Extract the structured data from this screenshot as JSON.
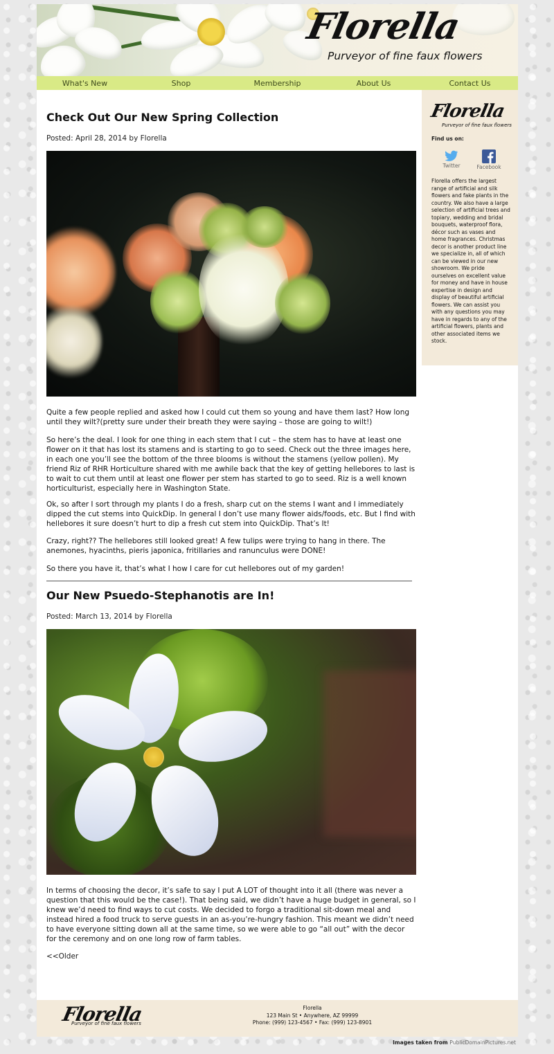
{
  "header": {
    "logo_title": "Florella",
    "logo_tagline": "Purveyor of fine faux flowers"
  },
  "nav": {
    "items": [
      "What's New",
      "Shop",
      "Membership",
      "About Us",
      "Contact Us"
    ]
  },
  "posts": [
    {
      "title": "Check Out Our New Spring Collection",
      "meta": "Posted: April 28, 2014 by Florella",
      "paragraphs": [
        "Quite a few people replied and asked how I could cut them so young and have them last? How long until they wilt?(pretty sure under their breath they were saying – those are going to wilt!)",
        "So here’s the deal. I look for one thing in each stem that I cut – the stem has to have at least one flower on it that has lost its stamens and is starting to go to seed. Check out the three images here, in each one you’ll see the bottom of the three blooms is without the stamens (yellow pollen). My friend Riz of RHR Horticulture shared with me awhile back that the key of getting hellebores to last is to wait to cut them until at least one flower per stem has started to go to seed. Riz is a well known horticulturist, especially here in Washington State.",
        "Ok, so after I sort through my plants I do a fresh, sharp cut on the stems I want and I immediately dipped the cut stems into QuickDip. In general I don’t use many flower aids/foods, etc. But I find with hellebores it sure doesn’t hurt to dip a fresh cut stem into QuickDip. That’s It!",
        "Crazy, right?? The hellebores still looked great! A few tulips were trying to hang in there. The anemones, hyacinths, pieris japonica, fritillaries and ranunculus were DONE!",
        "So there you have it, that’s what I how I care for cut hellebores out of my garden!"
      ]
    },
    {
      "title": "Our New Psuedo-Stephanotis are In!",
      "meta": "Posted: March 13, 2014 by Florella",
      "paragraphs": [
        "In terms of choosing the decor, it’s safe to say I put A LOT of thought into it all (there was never a question that this would be the case!). That being said, we didn’t have a huge budget in general, so I knew we’d need to find ways to cut costs. We decided to forgo a traditional sit-down meal and instead hired a food truck to serve guests in an as-you’re-hungry fashion. This meant we didn’t need to have everyone sitting down all at the same time, so we were able to go “all out” with the decor for the ceremony and on one long row of farm tables."
      ]
    }
  ],
  "pagination": {
    "older_label": "<<Older"
  },
  "sidebar": {
    "logo_title": "Florella",
    "logo_tagline": "Purveyor of fine faux flowers",
    "find_us_label": "Find us on:",
    "social": [
      {
        "label": "Twitter",
        "icon": "twitter-icon",
        "color": "#55acee"
      },
      {
        "label": "Facebook",
        "icon": "facebook-icon",
        "color": "#3b5998"
      }
    ],
    "about_text": "Florella offers the largest range of artificial and silk flowers and fake plants in the country. We also have a large selection of artificial trees and topiary, wedding and bridal bouquets, waterproof flora, décor such as vases and home fragrances. Christmas decor is another product line we specialize in, all of which can be viewed in our new showroom. We pride ourselves on excellent value for money and have in house expertise in design and display of beautiful artificial flowers. We can assist you with any questions you may have in regards to any of the artificial flowers, plants and other associated items we stock."
  },
  "footer": {
    "logo_title": "Florella",
    "logo_tagline": "Purveyor of fine faux flowers",
    "company": "Florella",
    "address": "123 Main St • Anywhere, AZ 99999",
    "contact": "Phone: (999) 123-4567 • Fax: (999) 123-8901"
  },
  "credit": {
    "prefix": "Images taken from ",
    "source": "PublicDomainPictures.net"
  },
  "colors": {
    "nav_bg": "#d9ea86",
    "sidebar_bg": "#f3eada",
    "footer_bg": "#f3eada"
  }
}
